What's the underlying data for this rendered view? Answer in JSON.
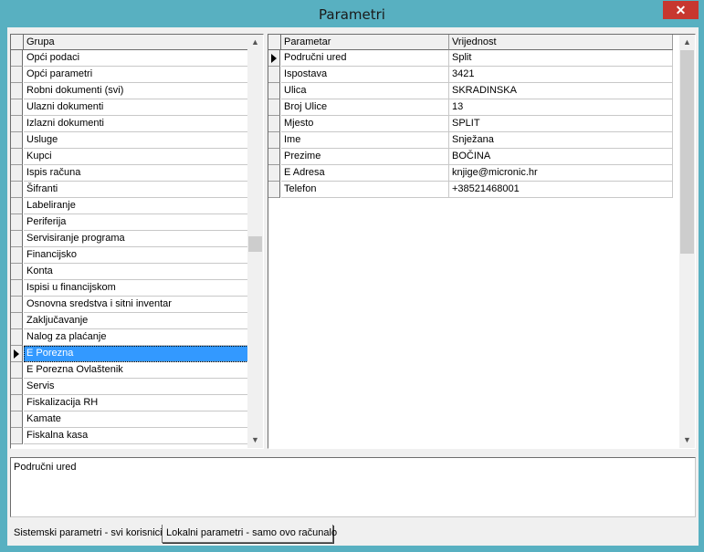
{
  "window": {
    "title": "Parametri",
    "close_glyph": "✕"
  },
  "groups": {
    "header": "Grupa",
    "items": [
      "Opći podaci",
      "Opći parametri",
      "Robni dokumenti (svi)",
      "Ulazni dokumenti",
      "Izlazni dokumenti",
      "Usluge",
      "Kupci",
      "Ispis računa",
      "Šifranti",
      "Labeliranje",
      "Periferija",
      "Servisiranje programa",
      "Financijsko",
      "Konta",
      "Ispisi u financijskom",
      "Osnovna sredstva i sitni inventar",
      "Zaključavanje",
      "Nalog za plaćanje",
      "E Porezna",
      "E Porezna Ovlaštenik",
      "Servis",
      "Fiskalizacija RH",
      "Kamate",
      "Fiskalna kasa"
    ],
    "selected_index": 18
  },
  "params": {
    "headers": [
      "Parametar",
      "Vrijednost"
    ],
    "rows": [
      [
        "Područni ured",
        "Split"
      ],
      [
        "Ispostava",
        "3421"
      ],
      [
        "Ulica",
        "SKRADINSKA"
      ],
      [
        "Broj Ulice",
        "13"
      ],
      [
        "Mjesto",
        "SPLIT"
      ],
      [
        "Ime",
        "Snježana"
      ],
      [
        "Prezime",
        "BOČINA"
      ],
      [
        "E Adresa",
        "knjige@micronic.hr"
      ],
      [
        "Telefon",
        "+38521468001"
      ]
    ],
    "current_index": 0
  },
  "description": {
    "text": "Područni ured"
  },
  "tabs": [
    {
      "label": "Sistemski parametri - svi korisnici",
      "active": true
    },
    {
      "label": "Lokalni parametri - samo ovo računalo",
      "active": false
    }
  ],
  "icons": {
    "scroll_up": "chevron-up-icon",
    "scroll_down": "chevron-down-icon",
    "row_pointer": "row-pointer-icon",
    "close": "close-icon"
  },
  "colors": {
    "titlebar": "#58b0c1",
    "selection": "#3399ff",
    "close_button": "#c7372f",
    "window_bg": "#f0f0f0"
  }
}
